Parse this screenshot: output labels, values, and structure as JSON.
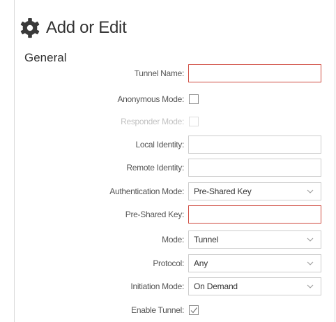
{
  "header": {
    "title": "Add or Edit",
    "icon": "gear-icon"
  },
  "section": {
    "title": "General"
  },
  "fields": {
    "tunnel_name": {
      "label": "Tunnel Name:",
      "value": ""
    },
    "anonymous_mode": {
      "label": "Anonymous Mode:",
      "checked": false
    },
    "responder_mode": {
      "label": "Responder Mode:",
      "checked": false,
      "disabled": true
    },
    "local_identity": {
      "label": "Local Identity:",
      "value": ""
    },
    "remote_identity": {
      "label": "Remote Identity:",
      "value": ""
    },
    "authentication_mode": {
      "label": "Authentication Mode:",
      "value": "Pre-Shared Key"
    },
    "pre_shared_key": {
      "label": "Pre-Shared Key:",
      "value": ""
    },
    "mode": {
      "label": "Mode:",
      "value": "Tunnel"
    },
    "protocol": {
      "label": "Protocol:",
      "value": "Any"
    },
    "initiation_mode": {
      "label": "Initiation Mode:",
      "value": "On Demand"
    },
    "enable_tunnel": {
      "label": "Enable Tunnel:",
      "checked": true
    }
  },
  "colors": {
    "invalid_border": "#cf4a3f",
    "icon": "#3a3a3a"
  }
}
